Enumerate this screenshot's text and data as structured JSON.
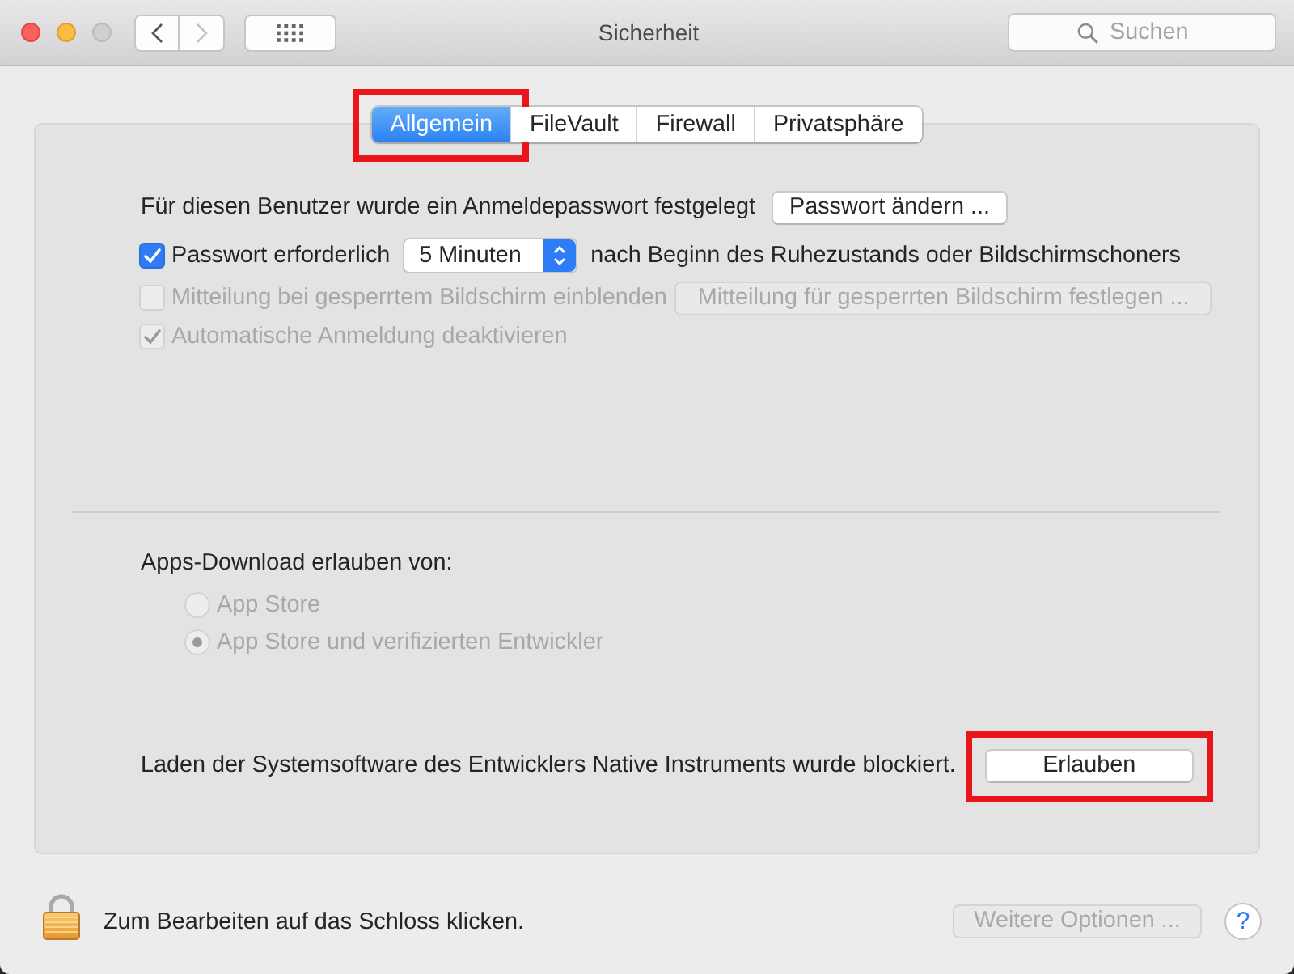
{
  "window": {
    "title": "Sicherheit"
  },
  "toolbar": {
    "back": {
      "disabled": false
    },
    "forward": {
      "disabled": true
    },
    "search": {
      "placeholder": "Suchen"
    }
  },
  "tabs": [
    {
      "label": "Allgemein",
      "selected": true,
      "highlighted": true
    },
    {
      "label": "FileVault",
      "selected": false,
      "highlighted": false
    },
    {
      "label": "Firewall",
      "selected": false,
      "highlighted": false
    },
    {
      "label": "Privatsphäre",
      "selected": false,
      "highlighted": false
    }
  ],
  "login_password": {
    "text": "Für diesen Benutzer wurde ein Anmeldepasswort festgelegt",
    "button": "Passwort ändern ..."
  },
  "options": [
    {
      "kind": "popup",
      "label": "Passwort erforderlich",
      "checked": true,
      "disabled": false,
      "popup": "5 Minuten",
      "suffix": "nach Beginn des Ruhezustands oder Bildschirmschoners"
    },
    {
      "kind": "button",
      "label": "Mitteilung bei gesperrtem Bildschirm einblenden",
      "checked": false,
      "disabled": true,
      "button": "Mitteilung für gesperrten Bildschirm festlegen ..."
    },
    {
      "kind": "plain",
      "label": "Automatische Anmeldung deaktivieren",
      "checked": true,
      "disabled": true
    }
  ],
  "downloads": {
    "label": "Apps-Download erlauben von:",
    "choices": [
      {
        "label": "App Store",
        "selected": false,
        "disabled": true
      },
      {
        "label": "App Store und verifizierten Entwickler",
        "selected": true,
        "disabled": true
      }
    ]
  },
  "blocked": {
    "text": "Laden der Systemsoftware des Entwicklers Native Instruments wurde blockiert.",
    "button": "Erlauben",
    "highlighted": true
  },
  "footer": {
    "lock_text": "Zum Bearbeiten auf das Schloss klicken.",
    "options_button": {
      "label": "Weitere Optionen ...",
      "disabled": true
    },
    "help": "?"
  }
}
